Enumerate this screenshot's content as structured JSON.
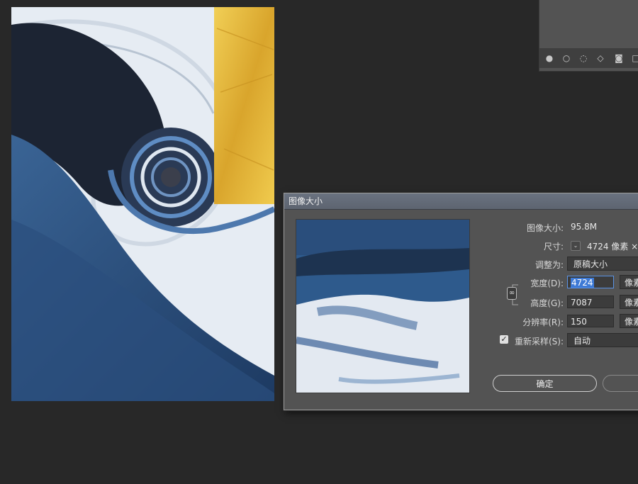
{
  "dialog": {
    "title": "图像大小",
    "image_size_label": "图像大小:",
    "image_size_value": "95.8M",
    "dimensions_label": "尺寸:",
    "dimensions_value": "4724 像素 ×",
    "fit_label": "调整为:",
    "fit_value": "原稿大小",
    "width_label": "宽度(D):",
    "width_value": "4724",
    "width_unit": "像素",
    "height_label": "高度(G):",
    "height_value": "7087",
    "height_unit": "像素",
    "resolution_label": "分辨率(R):",
    "resolution_value": "150",
    "resolution_unit": "像素",
    "resample_label": "重新采样(S):",
    "resample_value": "自动",
    "resample_checked": true,
    "ok_label": "确定",
    "cancel_label": ""
  },
  "icons": {
    "dimensions_chevron": "chevron-down-icon",
    "link": "link-icon",
    "checkbox": "checkmark-icon"
  },
  "colors": {
    "accent_blue": "#3e7ad6",
    "navy": "#1f2b3d",
    "gold": "#e2b43a",
    "panel": "#535353"
  }
}
